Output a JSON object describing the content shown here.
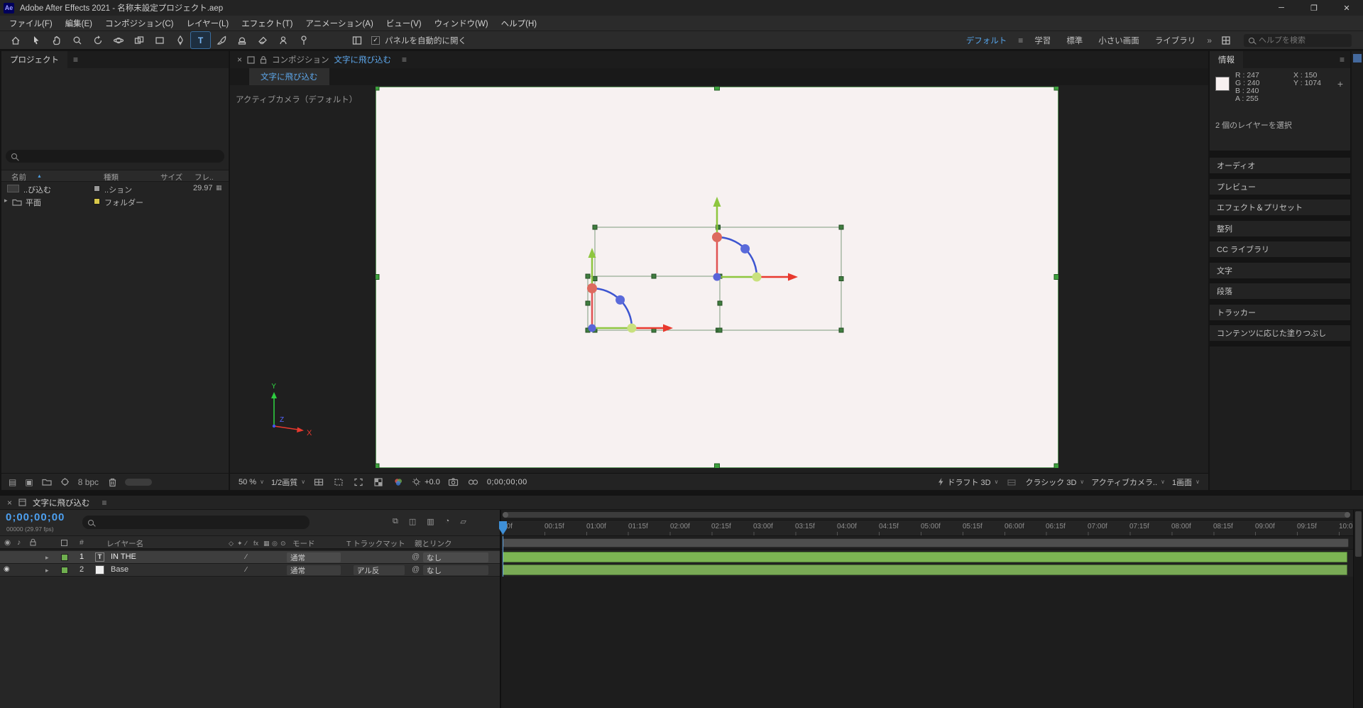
{
  "titlebar": {
    "app_badge": "Ae",
    "title": "Adobe After Effects 2021 - 名称未設定プロジェクト.aep"
  },
  "glyphs": {
    "min": "─",
    "max": "❐",
    "win_close": "✕",
    "panel_menu": "≡",
    "close": "×",
    "caret": "∨",
    "sort_asc": "▲",
    "expander": "▸",
    "overflow": "»",
    "pick_whip": "@",
    "check": "✓",
    "eye": "◉",
    "audio": "♪",
    "quality_switch": "∕",
    "usage": "▦",
    "flowchart": "▤",
    "new_comp": "▣",
    "switches": [
      "◇",
      "✦",
      "∕",
      "fx",
      "▦",
      "◎",
      "⊙"
    ],
    "mini_icons": [
      "⧉",
      "◫",
      "▥",
      "◔",
      "▱"
    ]
  },
  "menubar": {
    "items": [
      "ファイル(F)",
      "編集(E)",
      "コンポジション(C)",
      "レイヤー(L)",
      "エフェクト(T)",
      "アニメーション(A)",
      "ビュー(V)",
      "ウィンドウ(W)",
      "ヘルプ(H)"
    ]
  },
  "toolbar": {
    "type_tool": "T",
    "auto_open_label": "パネルを自動的に開く",
    "workspaces": [
      "デフォルト",
      "学習",
      "標準",
      "小さい画面",
      "ライブラリ"
    ],
    "search_placeholder": "ヘルプを検索"
  },
  "project": {
    "tab": "プロジェクト",
    "columns": {
      "name": "名前",
      "type": "種類",
      "size": "サイズ",
      "frames": "フレ.."
    },
    "rows": [
      {
        "name": "..び込む",
        "type": "..ション",
        "fps": "29.97"
      },
      {
        "name": "平面",
        "type": "フォルダー",
        "fps": ""
      }
    ],
    "bpc": "8 bpc"
  },
  "comp": {
    "panel_label": "コンポジション",
    "comp_name": "文字に飛び込む",
    "view_label": "アクティブカメラ（デフォルト）",
    "zoom": "50 %",
    "quality": "1/2画質",
    "exposure": "+0.0",
    "timecode": "0;00;00;00",
    "fast_previews": "ドラフト 3D",
    "renderer": "クラシック 3D",
    "view_camera": "アクティブカメラ..",
    "view_layout": "1画面",
    "axis_x": "X",
    "axis_y": "Y",
    "axis_z": "Z"
  },
  "info": {
    "tab": "情報",
    "channels": [
      {
        "label": "R :",
        "value": "247"
      },
      {
        "label": "G :",
        "value": "240"
      },
      {
        "label": "B :",
        "value": "240"
      },
      {
        "label": "A :",
        "value": "255"
      }
    ],
    "coords": [
      {
        "label": "X :",
        "value": "150"
      },
      {
        "label": "Y :",
        "value": "1074"
      }
    ],
    "status": "2 個のレイヤーを選択"
  },
  "right_panels": [
    "オーディオ",
    "プレビュー",
    "エフェクト＆プリセット",
    "整列",
    "CC ライブラリ",
    "文字",
    "段落",
    "トラッカー",
    "コンテンツに応じた塗りつぶし"
  ],
  "timeline": {
    "tab": "文字に飛び込む",
    "timecode": "0;00;00;00",
    "frame_info": "00000 (29.97 fps)",
    "headers": {
      "hash": "#",
      "name": "レイヤー名",
      "mode": "モード",
      "matte": "T トラックマット",
      "parent": "親とリンク"
    },
    "layers": [
      {
        "index": "1",
        "type_badge": "T",
        "name": "IN THE",
        "mode": "通常",
        "matte": "",
        "parent": "なし"
      },
      {
        "index": "2",
        "name": "Base",
        "mode": "通常",
        "matte": "アル反",
        "parent": "なし"
      }
    ],
    "ruler": [
      "00f",
      "00:15f",
      "01:00f",
      "01:15f",
      "02:00f",
      "02:15f",
      "03:00f",
      "03:15f",
      "04:00f",
      "04:15f",
      "05:00f",
      "05:15f",
      "06:00f",
      "06:15f",
      "07:00f",
      "07:15f",
      "08:00f",
      "08:15f",
      "09:00f",
      "09:15f",
      "10:0"
    ]
  }
}
